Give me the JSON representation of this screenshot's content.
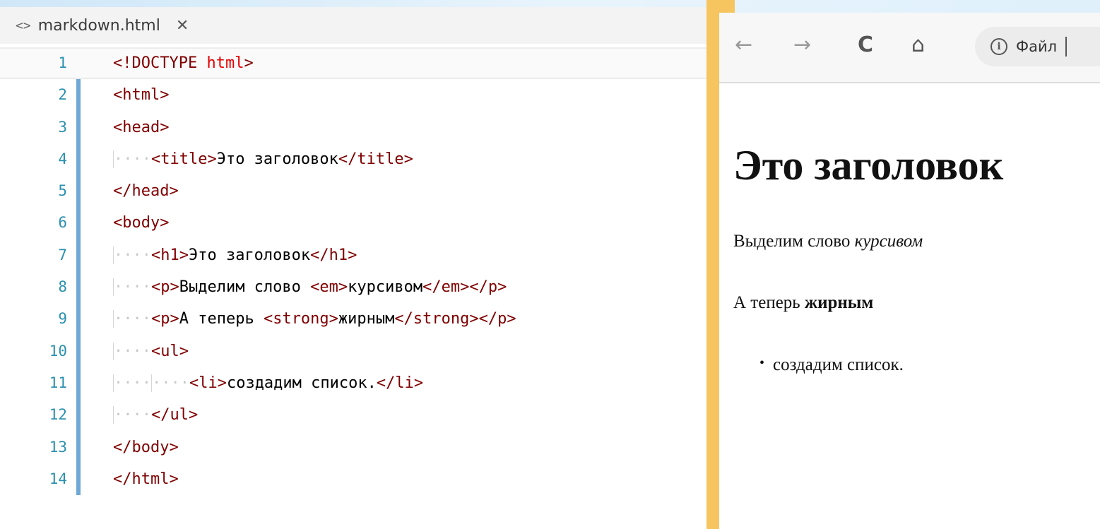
{
  "editor": {
    "tab": {
      "icon": "code-file-icon",
      "label": "markdown.html",
      "close": "✕"
    },
    "lines": [
      {
        "n": "1",
        "tokens": [
          {
            "c": "tag",
            "t": "<!DOCTYPE "
          },
          {
            "c": "attr",
            "t": "html"
          },
          {
            "c": "tag",
            "t": ">"
          }
        ]
      },
      {
        "n": "2",
        "tokens": [
          {
            "c": "tag",
            "t": "<html>"
          }
        ]
      },
      {
        "n": "3",
        "tokens": [
          {
            "c": "tag",
            "t": "<head>"
          }
        ]
      },
      {
        "n": "4",
        "indent": 1,
        "tokens": [
          {
            "c": "tag",
            "t": "<title>"
          },
          {
            "c": "txt",
            "t": "Это заголовок"
          },
          {
            "c": "tag",
            "t": "</title>"
          }
        ]
      },
      {
        "n": "5",
        "tokens": [
          {
            "c": "tag",
            "t": "</head>"
          }
        ]
      },
      {
        "n": "6",
        "tokens": [
          {
            "c": "tag",
            "t": "<body>"
          }
        ]
      },
      {
        "n": "7",
        "indent": 1,
        "tokens": [
          {
            "c": "tag",
            "t": "<h1>"
          },
          {
            "c": "txt",
            "t": "Это заголовок"
          },
          {
            "c": "tag",
            "t": "</h1>"
          }
        ]
      },
      {
        "n": "8",
        "indent": 1,
        "tokens": [
          {
            "c": "tag",
            "t": "<p>"
          },
          {
            "c": "txt",
            "t": "Выделим слово "
          },
          {
            "c": "tag",
            "t": "<em>"
          },
          {
            "c": "txt",
            "t": "курсивом"
          },
          {
            "c": "tag",
            "t": "</em></p>"
          }
        ]
      },
      {
        "n": "9",
        "indent": 1,
        "tokens": [
          {
            "c": "tag",
            "t": "<p>"
          },
          {
            "c": "txt",
            "t": "А теперь "
          },
          {
            "c": "tag",
            "t": "<strong>"
          },
          {
            "c": "txt",
            "t": "жирным"
          },
          {
            "c": "tag",
            "t": "</strong></p>"
          }
        ]
      },
      {
        "n": "10",
        "indent": 1,
        "tokens": [
          {
            "c": "tag",
            "t": "<ul>"
          }
        ]
      },
      {
        "n": "11",
        "indent": 2,
        "tokens": [
          {
            "c": "tag",
            "t": "<li>"
          },
          {
            "c": "txt",
            "t": "создадим список."
          },
          {
            "c": "tag",
            "t": "</li>"
          }
        ]
      },
      {
        "n": "12",
        "indent": 1,
        "tokens": [
          {
            "c": "tag",
            "t": "</ul>"
          }
        ]
      },
      {
        "n": "13",
        "tokens": [
          {
            "c": "tag",
            "t": "</body>"
          }
        ]
      },
      {
        "n": "14",
        "tokens": [
          {
            "c": "tag",
            "t": "</html>"
          }
        ]
      }
    ]
  },
  "browser": {
    "back": "←",
    "forward": "→",
    "reload": "C",
    "home": "⌂",
    "address_label": "Файл",
    "info_glyph": "i",
    "page": {
      "h1": "Это заголовок",
      "p1_text": "Выделим слово ",
      "p1_em": "курсивом",
      "p2_text": "А теперь ",
      "p2_strong": "жирным",
      "list_item": "создадим список.",
      "bullet": "•"
    }
  },
  "colors": {
    "tag": "#800000",
    "attr": "#e50000",
    "line_number": "#2b91af",
    "gutter_bar": "#6fa8d6",
    "splitter": "#f6c560"
  }
}
